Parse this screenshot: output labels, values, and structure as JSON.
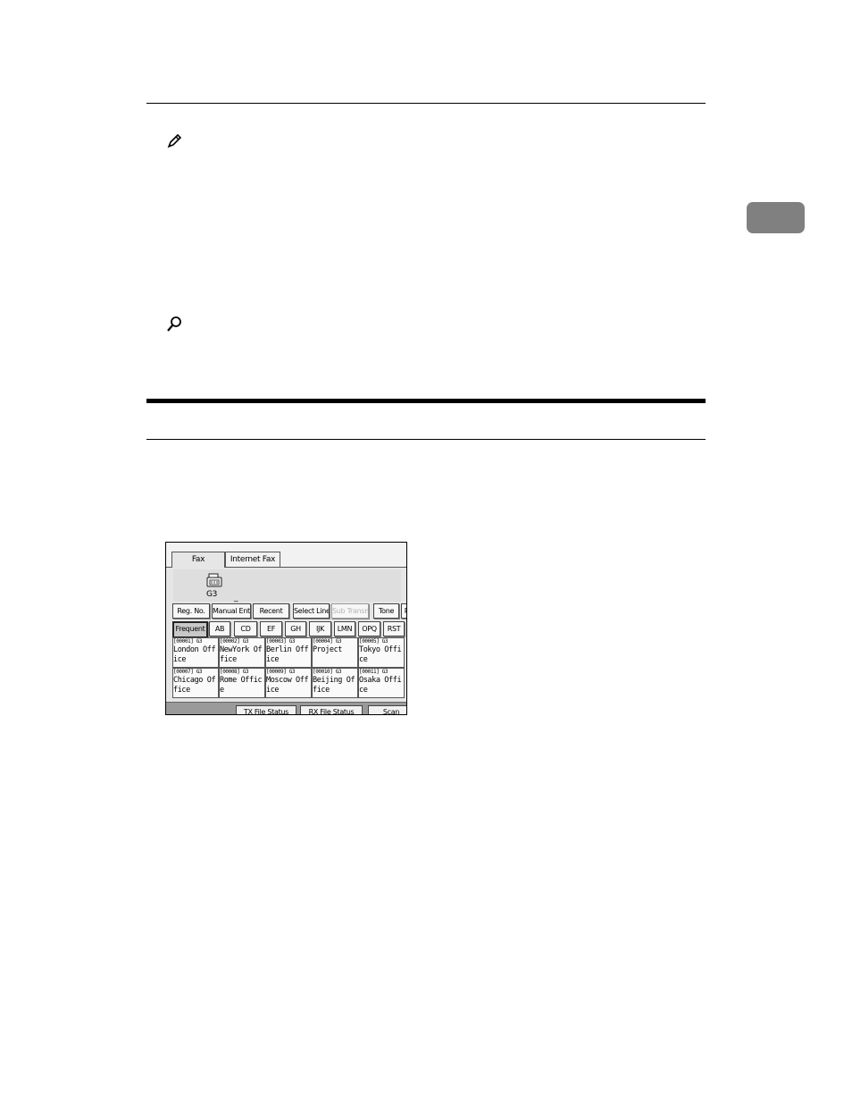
{
  "panel": {
    "tabs": [
      "Fax",
      "Internet Fax"
    ],
    "line_type": "G3",
    "cursor": "_",
    "function_buttons": [
      {
        "label": "Reg. No.",
        "enabled": true
      },
      {
        "label": "Manual Entry",
        "enabled": true
      },
      {
        "label": "Recent",
        "enabled": true
      },
      {
        "label": "Select Line",
        "enabled": true
      },
      {
        "label": "Sub Transmit",
        "enabled": false
      },
      {
        "label": "Tone",
        "enabled": true
      },
      {
        "label": "P",
        "enabled": true
      }
    ],
    "title_keys": [
      "Frequent",
      "AB",
      "CD",
      "EF",
      "GH",
      "IJK",
      "LMN",
      "OPQ",
      "RST"
    ],
    "destinations": [
      {
        "code": "[00001] G3",
        "line1": "London Off",
        "line2": "ice"
      },
      {
        "code": "[00002] G3",
        "line1": "NewYork Of",
        "line2": "fice"
      },
      {
        "code": "[00003] G3",
        "line1": "Berlin Off",
        "line2": "ice"
      },
      {
        "code": "[00004] G3",
        "line1": "Project",
        "line2": ""
      },
      {
        "code": "[00005] G3",
        "line1": "Tokyo Offi",
        "line2": "ce"
      },
      {
        "code": "[00007] G3",
        "line1": "Chicago Of",
        "line2": "fice"
      },
      {
        "code": "[00008] G3",
        "line1": "Rome Offic",
        "line2": "e"
      },
      {
        "code": "[00009] G3",
        "line1": "Moscow Off",
        "line2": "ice"
      },
      {
        "code": "[00010] G3",
        "line1": "Beijing Of",
        "line2": "fice"
      },
      {
        "code": "[00011] G3",
        "line1": "Osaka Offi",
        "line2": "ce"
      }
    ],
    "status_buttons": [
      "TX File Status",
      "RX File Status",
      "Scan"
    ]
  }
}
